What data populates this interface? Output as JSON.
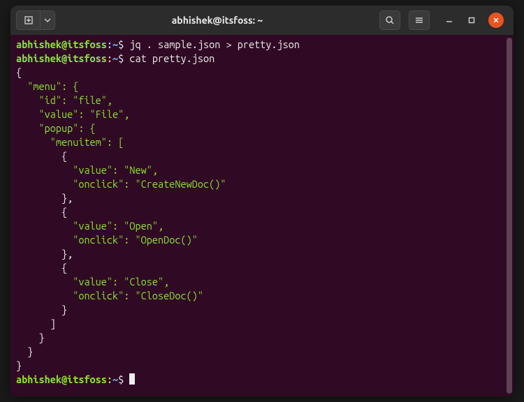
{
  "titlebar": {
    "title": "abhishek@itsfoss: ~"
  },
  "prompt": {
    "user_host": "abhishek@itsfoss",
    "path": "~",
    "symbol": "$"
  },
  "commands": {
    "cmd1": "jq . sample.json > pretty.json",
    "cmd2": "cat pretty.json"
  },
  "output": {
    "l01": "{",
    "l02": "  \"menu\": {",
    "l03": "    \"id\": \"file\",",
    "l04": "    \"value\": \"File\",",
    "l05": "    \"popup\": {",
    "l06": "      \"menuitem\": [",
    "l07": "        {",
    "l08": "          \"value\": \"New\",",
    "l09": "          \"onclick\": \"CreateNewDoc()\"",
    "l10": "        },",
    "l11": "        {",
    "l12": "          \"value\": \"Open\",",
    "l13": "          \"onclick\": \"OpenDoc()\"",
    "l14": "        },",
    "l15": "        {",
    "l16": "          \"value\": \"Close\",",
    "l17": "          \"onclick\": \"CloseDoc()\"",
    "l18": "        }",
    "l19": "      ]",
    "l20": "    }",
    "l21": "  }",
    "l22": "}"
  }
}
